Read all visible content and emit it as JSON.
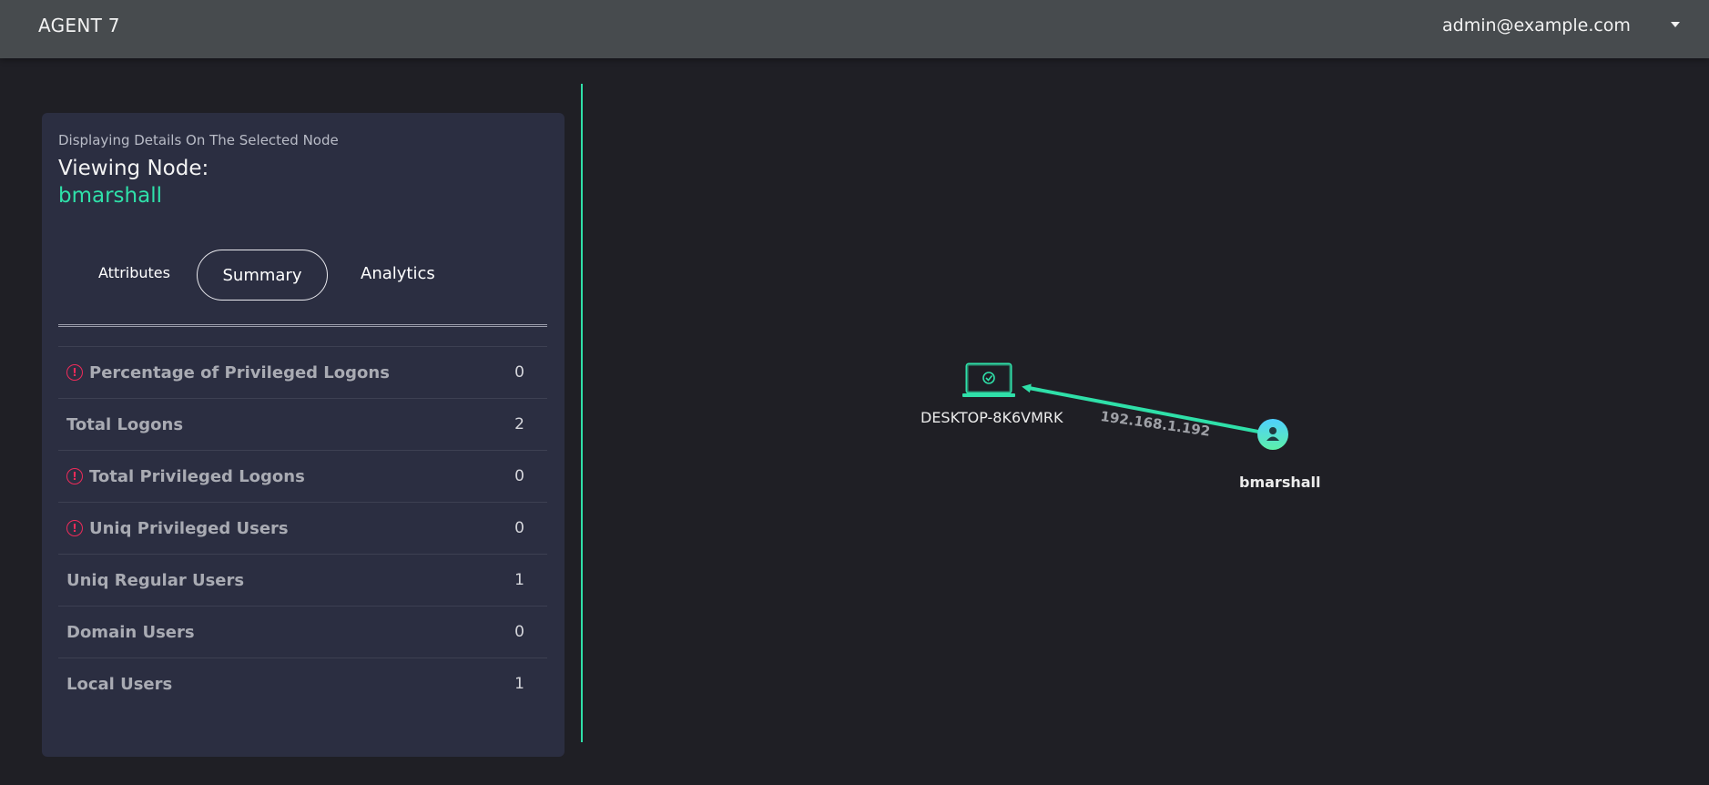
{
  "header": {
    "brand": "AGENT 7",
    "user_email": "admin@example.com",
    "menu_icon": "caret-down-icon"
  },
  "panel": {
    "caption": "Displaying Details On The Selected Node",
    "heading": "Viewing Node:",
    "node_name": "bmarshall",
    "tabs": [
      {
        "label": "Attributes",
        "active": false
      },
      {
        "label": "Summary",
        "active": true
      },
      {
        "label": "Analytics",
        "active": false
      }
    ],
    "stats": [
      {
        "label": "Percentage of Privileged Logons",
        "value": "0",
        "alert": true
      },
      {
        "label": "Total Logons",
        "value": "2",
        "alert": false
      },
      {
        "label": "Total Privileged Logons",
        "value": "0",
        "alert": true
      },
      {
        "label": "Uniq Privileged Users",
        "value": "0",
        "alert": true
      },
      {
        "label": "Uniq Regular Users",
        "value": "1",
        "alert": false
      },
      {
        "label": "Domain Users",
        "value": "0",
        "alert": false
      },
      {
        "label": "Local Users",
        "value": "1",
        "alert": false
      }
    ],
    "alert_icon": "exclamation-circle-icon"
  },
  "graph": {
    "nodes": [
      {
        "label": "DESKTOP-8K6VMRK",
        "icon": "laptop-check-icon"
      },
      {
        "label": "bmarshall",
        "icon": "user-icon"
      }
    ],
    "edge_label": "192.168.1.192",
    "accent_color": "#2fe0a9"
  }
}
